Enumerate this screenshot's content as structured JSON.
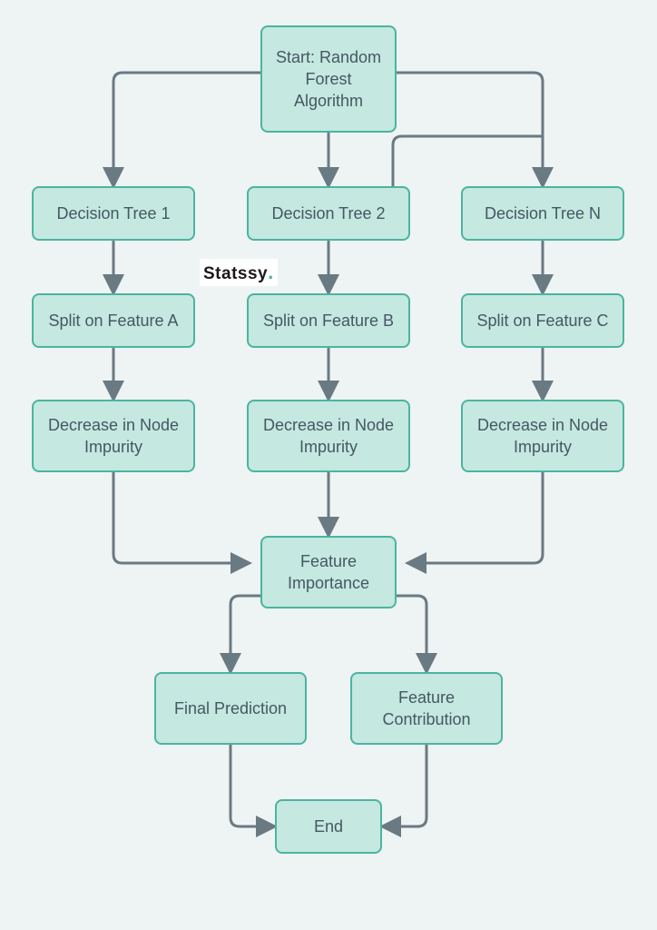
{
  "diagram": {
    "title_node": "Start: Random Forest Algorithm",
    "tree1": "Decision Tree 1",
    "tree2": "Decision Tree 2",
    "treeN": "Decision Tree N",
    "splitA": "Split on Feature A",
    "splitB": "Split on Feature B",
    "splitC": "Split on Feature C",
    "decrease1": "Decrease in Node Impurity",
    "decrease2": "Decrease in Node Impurity",
    "decrease3": "Decrease in Node Impurity",
    "feature_importance": "Feature Importance",
    "final_prediction": "Final Prediction",
    "feature_contribution": "Feature Contribution",
    "end": "End"
  },
  "watermark": {
    "text": "Statssy",
    "dot": "."
  },
  "colors": {
    "node_fill": "#c5e8e0",
    "node_border": "#4ab5a0",
    "arrow": "#6a7a82",
    "bg": "#eef3f4"
  }
}
